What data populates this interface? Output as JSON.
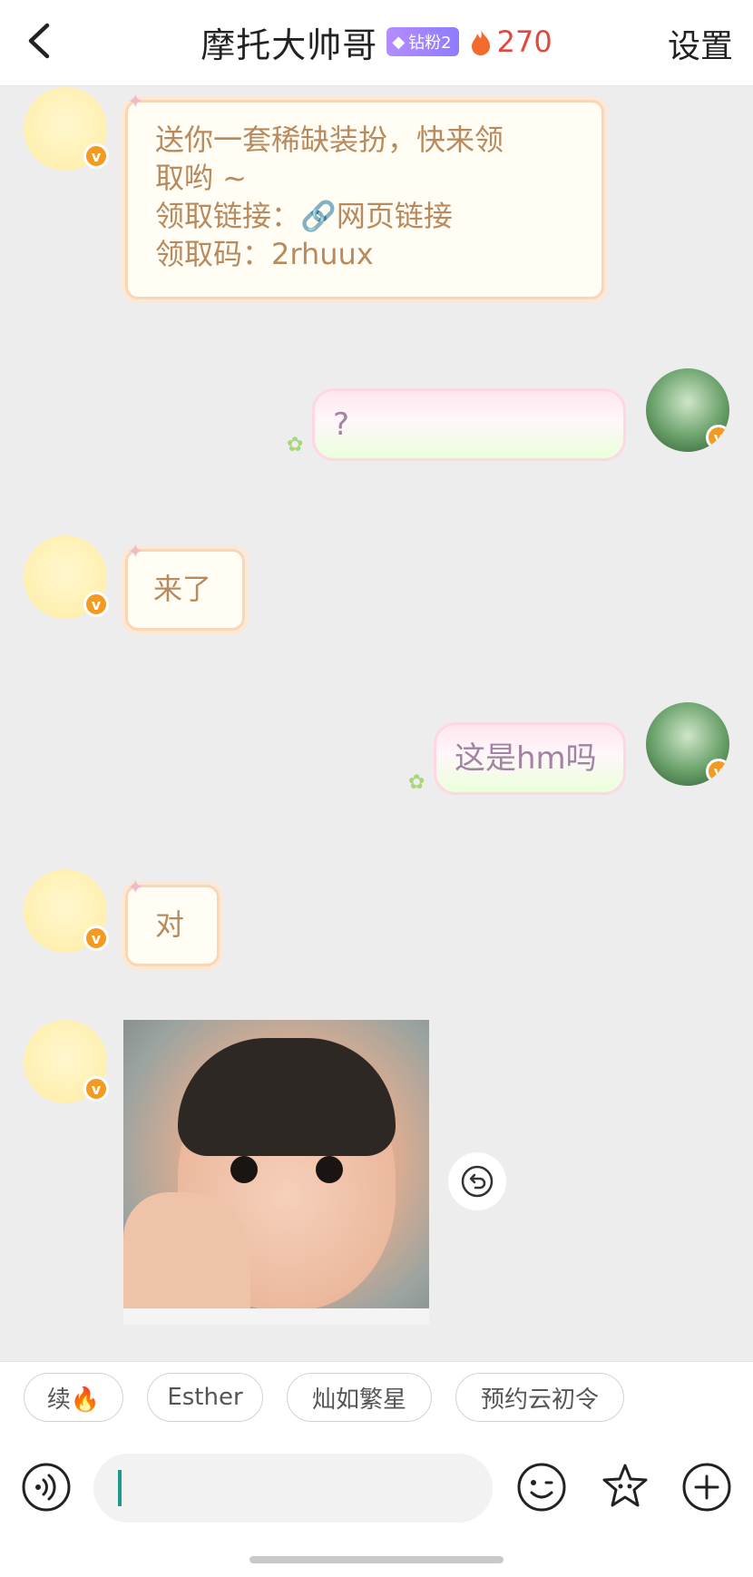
{
  "header": {
    "back_icon": "chevron-left-icon",
    "title": "摩托大帅哥",
    "fan_badge": "钻粉2",
    "fan_badge_icon": "diamond-icon",
    "streak_icon": "fire-icon",
    "streak_count": "270",
    "settings_label": "设置"
  },
  "messages": [
    {
      "from": "other",
      "type": "text",
      "lines": [
        "送你一套稀缺装扮，快来领",
        "取哟 ~",
        "领取链接：",
        "网页链接",
        "领取码：2rhuux"
      ]
    },
    {
      "from": "me",
      "type": "text",
      "text": "?"
    },
    {
      "from": "other",
      "type": "text",
      "text": "来了"
    },
    {
      "from": "me",
      "type": "text",
      "text": "这是hm吗"
    },
    {
      "from": "other",
      "type": "text",
      "text": "对"
    },
    {
      "from": "other",
      "type": "image",
      "image_semantic": "baby-smiling-photo"
    }
  ],
  "verified_badge": "v",
  "revoke_icon": "undo-icon",
  "quick_replies": [
    "续🔥",
    "Esther",
    "灿如繁星",
    "预约云初令"
  ],
  "input": {
    "value": "",
    "placeholder": ""
  },
  "toolbar_icons": [
    "voice-icon",
    "emoji-icon",
    "sticker-icon",
    "plus-icon"
  ],
  "colors": {
    "header_bg": "#ffffff",
    "chat_bg": "#ededed",
    "incoming_text": "#b88a5e",
    "streak": "#e4473c",
    "verified": "#f39a22",
    "caret": "#1e9a8c"
  }
}
